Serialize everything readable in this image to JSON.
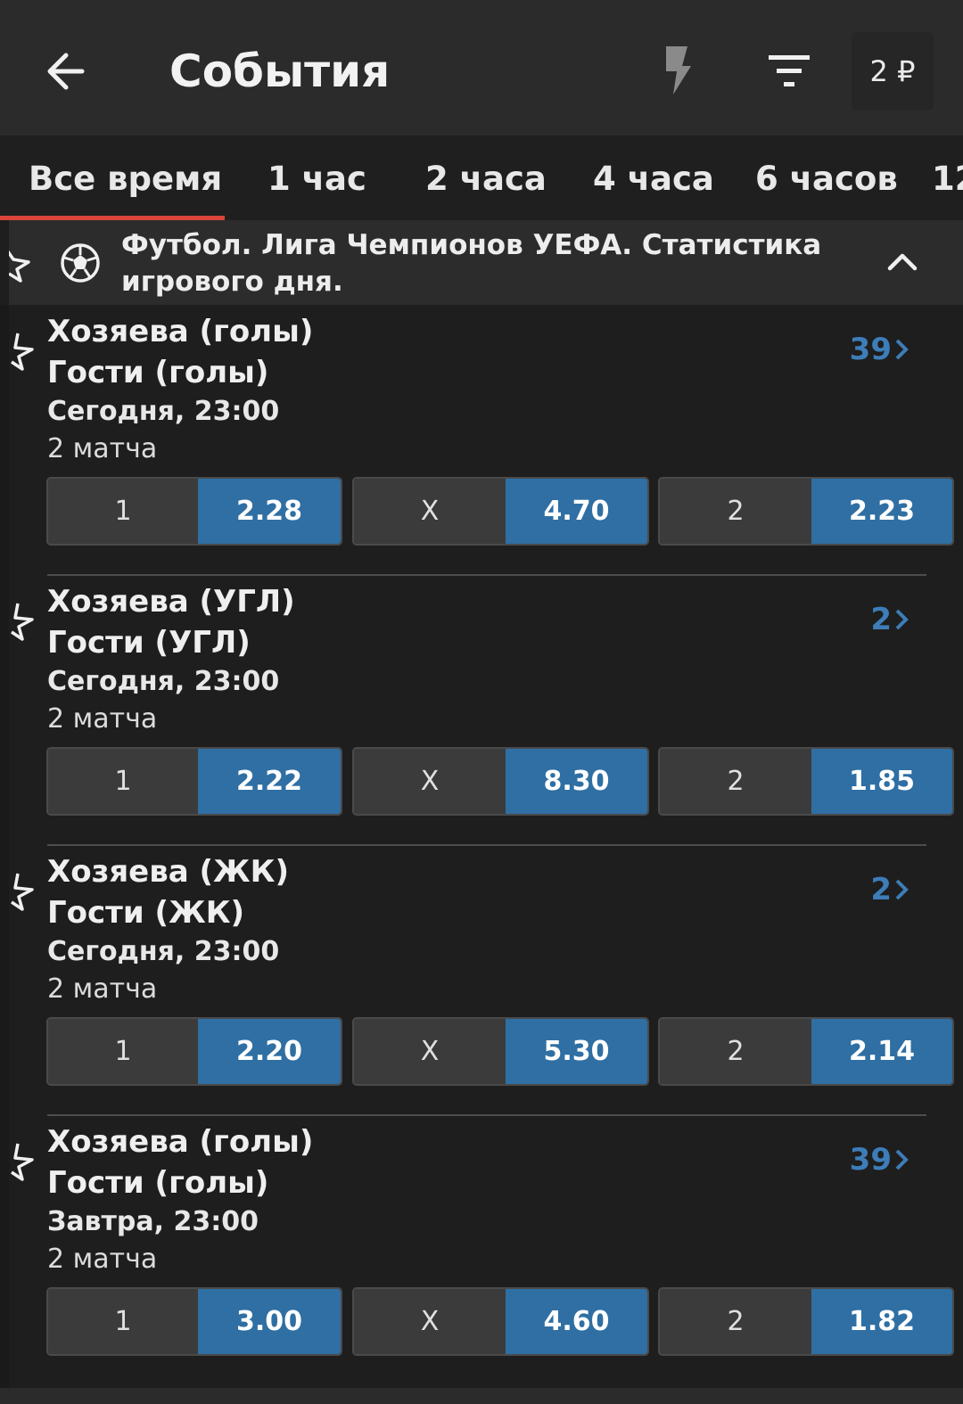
{
  "header": {
    "title": "События",
    "balance": "2 ₽"
  },
  "tabs": [
    {
      "label": "Все время",
      "active": true
    },
    {
      "label": "1 час"
    },
    {
      "label": "2 часа"
    },
    {
      "label": "4 часа"
    },
    {
      "label": "6 часов"
    },
    {
      "label": "12"
    }
  ],
  "league": {
    "line1": "Футбол. Лига Чемпионов УЕФА. Статистика",
    "line2": "игрового дня."
  },
  "events": [
    {
      "home": "Хозяева (голы)",
      "away": "Гости (голы)",
      "time": "Сегодня, 23:00",
      "matches": "2 матча",
      "markets": "39",
      "odds": [
        {
          "label": "1",
          "value": "2.28"
        },
        {
          "label": "X",
          "value": "4.70"
        },
        {
          "label": "2",
          "value": "2.23"
        }
      ]
    },
    {
      "home": "Хозяева (УГЛ)",
      "away": "Гости (УГЛ)",
      "time": "Сегодня, 23:00",
      "matches": "2 матча",
      "markets": "2",
      "odds": [
        {
          "label": "1",
          "value": "2.22"
        },
        {
          "label": "X",
          "value": "8.30"
        },
        {
          "label": "2",
          "value": "1.85"
        }
      ]
    },
    {
      "home": "Хозяева (ЖК)",
      "away": "Гости (ЖК)",
      "time": "Сегодня, 23:00",
      "matches": "2 матча",
      "markets": "2",
      "odds": [
        {
          "label": "1",
          "value": "2.20"
        },
        {
          "label": "X",
          "value": "5.30"
        },
        {
          "label": "2",
          "value": "2.14"
        }
      ]
    },
    {
      "home": "Хозяева (голы)",
      "away": "Гости (голы)",
      "time": "Завтра, 23:00",
      "matches": "2 матча",
      "markets": "39",
      "odds": [
        {
          "label": "1",
          "value": "3.00"
        },
        {
          "label": "X",
          "value": "4.60"
        },
        {
          "label": "2",
          "value": "1.82"
        }
      ]
    }
  ],
  "colors": {
    "accent": "#2f6fa3",
    "tab_indicator": "#d9453b",
    "markets_count": "#3d7db8"
  },
  "icons": [
    "back-arrow-icon",
    "lightning-icon",
    "filter-icon",
    "star-icon",
    "soccer-ball-icon",
    "chevron-up-icon",
    "chevron-right-icon"
  ]
}
